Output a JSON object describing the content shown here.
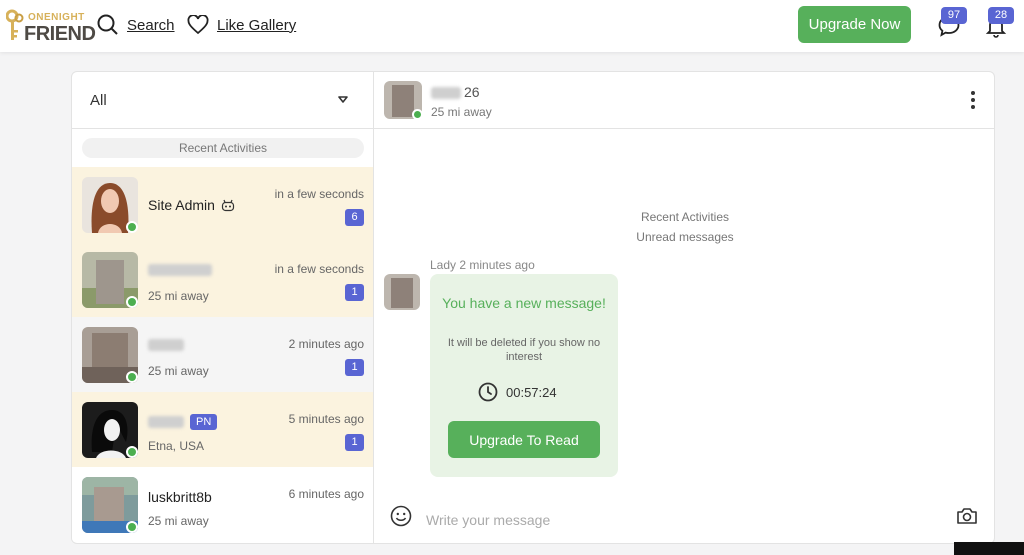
{
  "header": {
    "logo_line1": "ONENIGHT",
    "logo_line2": "FRIEND",
    "search_label": "Search",
    "like_gallery_label": "Like Gallery",
    "upgrade_label": "Upgrade Now",
    "messages_badge": "97",
    "notifications_badge": "28"
  },
  "sidebar": {
    "filter_value": "All",
    "recent_label": "Recent Activities",
    "conversations": [
      {
        "name": "Site Admin",
        "distance": "",
        "time": "in a few seconds",
        "count": "6",
        "highlighted": true
      },
      {
        "name": "",
        "distance": "25 mi away",
        "time": "in a few seconds",
        "count": "1",
        "highlighted": true
      },
      {
        "name": "",
        "distance": "25 mi away",
        "time": "2 minutes ago",
        "count": "1",
        "highlighted": false
      },
      {
        "name": "",
        "badge": "PN",
        "distance": "Etna, USA",
        "time": "5 minutes ago",
        "count": "1",
        "highlighted": true
      },
      {
        "name": "luskbritt8b",
        "distance": "25 mi away",
        "time": "6 minutes ago",
        "count": "",
        "highlighted": false
      }
    ]
  },
  "chat": {
    "age": "26",
    "distance": "25 mi away",
    "recent_label": "Recent Activities",
    "unread_label": "Unread messages",
    "sender": "Lady",
    "sent_time": "2 minutes ago",
    "bubble_title": "You have a new message!",
    "bubble_text": "It will be deleted if you show no interest",
    "countdown": "00:57:24",
    "upgrade_read_label": "Upgrade To Read",
    "composer_placeholder": "Write your message"
  },
  "colors": {
    "accent_green": "#57b05b",
    "badge_blue": "#5965d3",
    "highlight": "#fbf3df",
    "online": "#4caf50"
  }
}
